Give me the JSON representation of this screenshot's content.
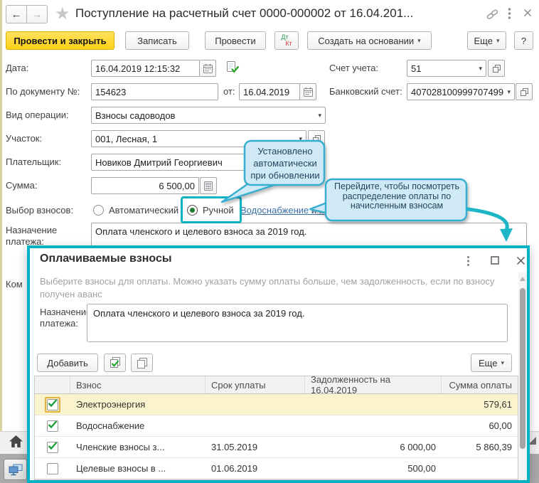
{
  "colors": {
    "accent_teal": "#00b2c4",
    "callout_fill": "#cfeaf6",
    "callout_border": "#35aed0",
    "selected_row": "#fbf3cd",
    "primary_button_yellow": "#ffd117",
    "link_blue": "#3a6ea5"
  },
  "icons": {
    "back_arrow": "←",
    "forward_arrow": "→",
    "favorite_star": "★",
    "dropdown_caret": "▾"
  },
  "window": {
    "title": "Поступление на расчетный счет 0000-000002 от 16.04.201...",
    "toolbar": {
      "post_close": "Провести и закрыть",
      "save": "Записать",
      "post": "Провести",
      "dt": "Дт",
      "kt": "Кт",
      "create_based": "Создать на основании",
      "more": "Еще",
      "help": "?"
    },
    "fields": {
      "date": {
        "label": "Дата:",
        "value": "16.04.2019 12:15:32"
      },
      "account": {
        "label": "Счет учета:",
        "value": "51"
      },
      "doc_no": {
        "label": "По документу №:",
        "value": "154623"
      },
      "doc_date": {
        "label": "от:",
        "value": "16.04.2019"
      },
      "bank_account": {
        "label": "Банковский счет:",
        "value": "407028100999707499"
      },
      "operation": {
        "label": "Вид операции:",
        "value": "Взносы садоводов"
      },
      "plot": {
        "label": "Участок:",
        "value": "001, Лесная, 1"
      },
      "payer": {
        "label": "Плательщик:",
        "value": "Новиков Дмитрий Георгиевич"
      },
      "amount": {
        "label": "Сумма:",
        "value": "6 500,00"
      },
      "fee_choice": {
        "label": "Выбор взносов:",
        "auto": "Автоматический",
        "manual": "Ручной",
        "selected": "manual",
        "link": "Водоснабжение и ..."
      },
      "purpose": {
        "label": "Назначение платежа:",
        "value": "Оплата членского и целевого взноса за 2019 год."
      },
      "comment_fragment": "Ком"
    }
  },
  "callouts": {
    "c1": "Установлено автоматически при обновлении",
    "c2": "Перейдите, чтобы посмотреть распределение оплаты по начисленным взносам"
  },
  "modal": {
    "title": "Оплачиваемые взносы",
    "hint": "Выберите взносы для оплаты. Можно указать сумму оплаты больше, чем задолженность, если по взносу получен аванс",
    "purpose": {
      "label": "Назначение платежа:",
      "value": "Оплата членского и целевого взноса за 2019 год."
    },
    "buttons": {
      "add": "Добавить",
      "more": "Еще"
    },
    "table": {
      "headers": [
        "Взнос",
        "Срок уплаты",
        "Задолженность на 16.04.2019",
        "Сумма оплаты"
      ],
      "rows": [
        {
          "checked": true,
          "selected": true,
          "fee": "Электроэнергия",
          "due": "",
          "debt": "",
          "amount": "579,61"
        },
        {
          "checked": true,
          "selected": false,
          "fee": "Водоснабжение",
          "due": "",
          "debt": "",
          "amount": "60,00"
        },
        {
          "checked": true,
          "selected": false,
          "fee": "Членские взносы з...",
          "due": "31.05.2019",
          "debt": "6 000,00",
          "amount": "5 860,39"
        },
        {
          "checked": false,
          "selected": false,
          "fee": "Целевые взносы в ...",
          "due": "01.06.2019",
          "debt": "500,00",
          "amount": ""
        }
      ]
    }
  }
}
